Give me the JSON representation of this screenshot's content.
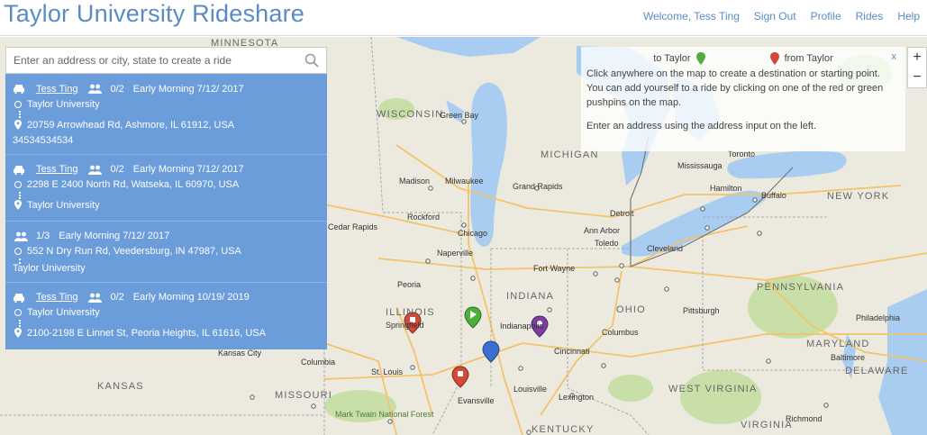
{
  "brand": "Taylor University Rideshare",
  "nav": {
    "welcome": "Welcome, Tess Ting",
    "sign_out": "Sign Out",
    "profile": "Profile",
    "rides": "Rides",
    "help": "Help"
  },
  "search": {
    "placeholder": "Enter an address or city, state to create a ride"
  },
  "rides": [
    {
      "driver": "Tess Ting",
      "seats": "0/2",
      "time": "Early Morning 7/12/ 2017",
      "from": "Taylor University",
      "to": "20759 Arrowhead Rd, Ashmore, IL 61912, USA",
      "note": "34534534534"
    },
    {
      "driver": "Tess Ting",
      "seats": "0/2",
      "time": "Early Morning 7/12/ 2017",
      "from": "2298 E 2400 North Rd, Watseka, IL 60970, USA",
      "to": "Taylor University"
    },
    {
      "seats": "1/3",
      "time": "Early Morning 7/12/ 2017",
      "from": "552 N Dry Run Rd, Veedersburg, IN 47987, USA",
      "to": "Taylor University"
    },
    {
      "driver": "Tess Ting",
      "seats": "0/2",
      "time": "Early Morning 10/19/ 2019",
      "from": "Taylor University",
      "to": "2100-2198 E Linnet St, Peoria Heights, IL 61616, USA"
    }
  ],
  "info": {
    "to_taylor": "to Taylor",
    "from_taylor": "from Taylor",
    "close": "x",
    "line1": "Click anywhere on the map to create a destination or starting point.",
    "line2": "You can add yourself to a ride by clicking on one of the red or green pushpins on the map.",
    "line3": "Enter an address using the address input on the left."
  },
  "zoom": {
    "in": "+",
    "out": "−"
  },
  "map": {
    "states": [
      "MINNESOTA",
      "WISCONSIN",
      "MICHIGAN",
      "ILLINOIS",
      "INDIANA",
      "OHIO",
      "PENNSYLVANIA",
      "NEW YORK",
      "MISSOURI",
      "KANSAS",
      "KENTUCKY",
      "WEST VIRGINIA",
      "VIRGINIA",
      "MARYLAND",
      "DELAWARE"
    ],
    "cities": [
      "Green Bay",
      "Madison",
      "Milwaukee",
      "Grand Rapids",
      "Rockford",
      "Chicago",
      "Naperville",
      "Ann Arbor",
      "Detroit",
      "Toledo",
      "Cleveland",
      "Mississauga",
      "Toronto",
      "Hamilton",
      "Buffalo",
      "Fort Wayne",
      "Springfield",
      "Indianapolis",
      "Columbus",
      "Cincinnati",
      "Kansas City",
      "Columbia",
      "St. Louis",
      "Louisville",
      "Lexington",
      "Evansville",
      "Pittsburgh",
      "Philadelphia",
      "Baltimore",
      "Richmond",
      "Peoria",
      "Cedar Rapids",
      "Mark Twain National Forest"
    ]
  },
  "colors": {
    "accent": "#5a8bc4",
    "panel": "#6b9ddb",
    "water": "#a9cdf0",
    "land": "#eceadf",
    "park": "#c8dfa8",
    "pin_red": "#d24b3a",
    "pin_green": "#4caf3c",
    "pin_blue": "#3b6fd1",
    "pin_purple": "#7b3fa0"
  }
}
